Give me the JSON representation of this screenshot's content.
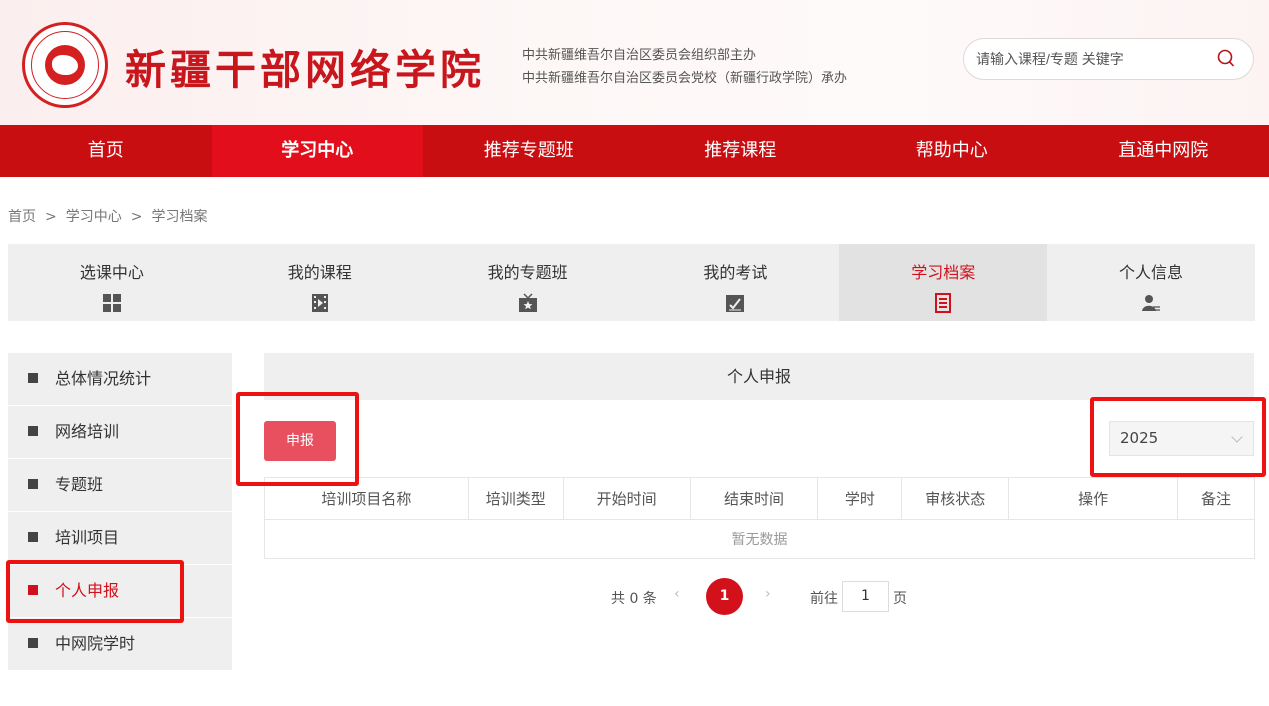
{
  "header": {
    "title": "新疆干部网络学院",
    "sponsor_line1": "中共新疆维吾尔自治区委员会组织部主办",
    "sponsor_line2": "中共新疆维吾尔自治区委员会党校（新疆行政学院）承办",
    "search_placeholder": "请输入课程/专题 关键字"
  },
  "nav": [
    {
      "label": "首页"
    },
    {
      "label": "学习中心"
    },
    {
      "label": "推荐专题班"
    },
    {
      "label": "推荐课程"
    },
    {
      "label": "帮助中心"
    },
    {
      "label": "直通中网院"
    }
  ],
  "breadcrumb": [
    "首页",
    "学习中心",
    "学习档案"
  ],
  "breadcrumb_sep": ">",
  "tabs": [
    {
      "label": "选课中心",
      "icon": "grid-icon"
    },
    {
      "label": "我的课程",
      "icon": "film-icon"
    },
    {
      "label": "我的专题班",
      "icon": "star-board-icon"
    },
    {
      "label": "我的考试",
      "icon": "exam-edit-icon"
    },
    {
      "label": "学习档案",
      "icon": "archive-list-icon"
    },
    {
      "label": "个人信息",
      "icon": "user-info-icon"
    }
  ],
  "sidebar": [
    {
      "label": "总体情况统计"
    },
    {
      "label": "网络培训"
    },
    {
      "label": "专题班"
    },
    {
      "label": "培训项目"
    },
    {
      "label": "个人申报"
    },
    {
      "label": "中网院学时"
    }
  ],
  "panel": {
    "title": "个人申报",
    "report_button": "申报",
    "year": "2025",
    "columns": [
      "培训项目名称",
      "培训类型",
      "开始时间",
      "结束时间",
      "学时",
      "审核状态",
      "操作",
      "备注"
    ],
    "empty_text": "暂无数据"
  },
  "pagination": {
    "total_text": "共 0 条",
    "prev": "‹",
    "current": "1",
    "next": "›",
    "goto_label": "前往",
    "goto_value": "1",
    "unit": "页"
  },
  "colors": {
    "brand_red": "#c90e12",
    "active_red": "#d0111b",
    "report_button": "#e8505f",
    "annotation": "#ee1111"
  }
}
